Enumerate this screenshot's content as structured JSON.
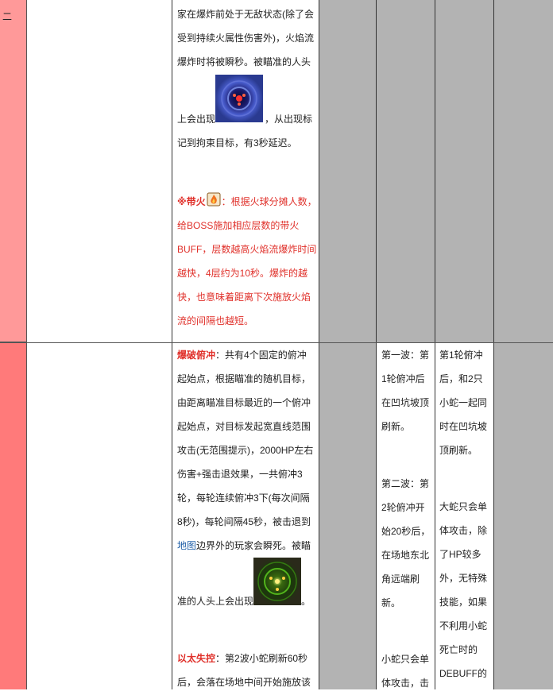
{
  "row_top": {
    "label": "二",
    "lines": [
      "家在爆炸前处于无敌状态(除了会",
      "受到持续火属性伤害外)，火焰流",
      "爆炸时将被瞬秒。被瞄准的人头"
    ],
    "icon_line_prefix": "上会出现",
    "icon_line_suffix": "，从出现标",
    "line_after_icon": "记到拘束目标，有3秒延迟。",
    "red_title": "※带火",
    "red_title_suffix": "：根据火球分摊人数，",
    "red_lines": [
      "给BOSS施加相应层数的带火",
      "BUFF，层数越高火焰流爆炸时间",
      "越快，4层约为10秒。爆炸的越",
      "快，也意味着距离下次施放火焰",
      "流的间隔也越短。"
    ],
    "icons": {
      "mark": "blue-vortex-mark-icon",
      "fire": "fire-buff-icon"
    }
  },
  "row_bottom": {
    "desc": {
      "title": "爆破俯冲",
      "first_line_suffix": "：共有4个固定的俯冲",
      "lines": [
        "起始点，根据瞄准的随机目标，",
        "由距离瞄准目标最近的一个俯冲",
        "起始点，对目标发起宽直线范围",
        "攻击(无范围提示)，2000HP左右",
        "伤害+强击退效果，一共俯冲3",
        "轮，每轮连续俯冲3下(每次间隔",
        "8秒)，每轮间隔45秒，被击退到"
      ],
      "map_link": "地图",
      "map_line_suffix": "边界外的玩家会瞬死。被瞄",
      "icon_line_prefix": "准的人头上会出现",
      "icon_line_suffix": "。",
      "title2": "以太失控",
      "title2_suffix": "：第2波小蛇刷新60秒",
      "last_line": "后，会落在场地中间开始施放该",
      "icon": "green-vortex-mark-icon"
    },
    "wave_col": [
      "第一波：第",
      "1轮俯冲后",
      "在凹坑坡顶",
      "刷新。",
      "",
      "第二波：第",
      "2轮俯冲开",
      "始20秒后，",
      "在场地东北",
      "角远端刷",
      "新。",
      "",
      "小蛇只会单",
      "体攻击，击"
    ],
    "note_col": [
      "第1轮俯冲",
      "后，和2只",
      "小蛇一起同",
      "时在凹坑坡",
      "顶刷新。",
      "",
      "大蛇只会单",
      "体攻击，除",
      "了HP较多",
      "外，无特殊",
      "技能，如果",
      "不利用小蛇",
      "死亡时的",
      "DEBUFF的"
    ]
  },
  "colors": {
    "row_top_label_bg": "#ff9999",
    "row_bottom_label_bg": "#ff7a7a",
    "gray": "#b3b3b3",
    "red_text": "#e0302a",
    "link": "#1f5fa8"
  }
}
